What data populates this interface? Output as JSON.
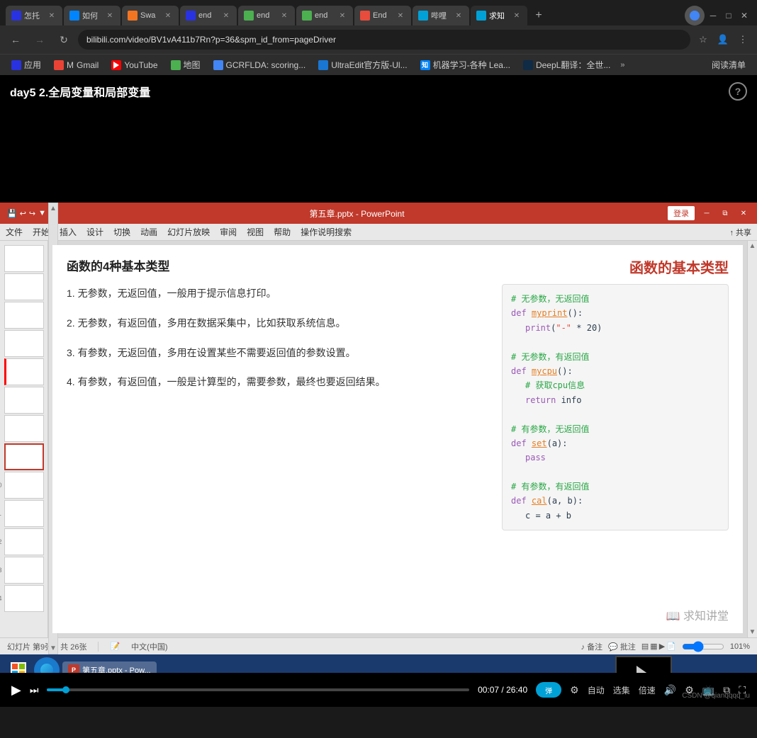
{
  "browser": {
    "tabs": [
      {
        "id": "t1",
        "label": "怎托",
        "fav_color": "#2932e1",
        "active": false
      },
      {
        "id": "t2",
        "label": "如何",
        "fav_color": "#0084ff",
        "active": false
      },
      {
        "id": "t3",
        "label": "Swa",
        "fav_color": "#f47521",
        "active": false
      },
      {
        "id": "t4",
        "label": "end",
        "fav_color": "#2932e1",
        "active": false
      },
      {
        "id": "t5",
        "label": "end",
        "fav_color": "#4caf50",
        "active": false
      },
      {
        "id": "t6",
        "label": "end",
        "fav_color": "#4caf50",
        "active": false
      },
      {
        "id": "t7",
        "label": "End",
        "fav_color": "#e74c3c",
        "active": false
      },
      {
        "id": "t8",
        "label": "哔哩",
        "fav_color": "#00a1d6",
        "active": false
      },
      {
        "id": "t9",
        "label": "求知",
        "fav_color": "#00a1d6",
        "active": true
      }
    ],
    "address": "bilibili.com/video/BV1vA411b7Rn?p=36&spm_id_from=pageDriver",
    "bookmarks": [
      {
        "label": "应用",
        "fav_color": "#2932e1"
      },
      {
        "label": "Gmail",
        "fav_color": "#ea4335"
      },
      {
        "label": "YouTube",
        "fav_color": "#ff0000"
      },
      {
        "label": "地图",
        "fav_color": "#4caf50"
      },
      {
        "label": "GCRFLDA: scoring...",
        "fav_color": "#4285f4"
      },
      {
        "label": "UltraEdit官方版-Ul...",
        "fav_color": "#1976d2"
      },
      {
        "label": "机器学习-各种 Lea...",
        "fav_color": "#0084ff"
      },
      {
        "label": "DeepL翻译：全世...",
        "fav_color": "#0f2b46"
      },
      {
        "label": "阅读清单",
        "fav_color": "#555"
      }
    ]
  },
  "video": {
    "title": "day5 2.全局变量和局部变量",
    "current_time": "00:07",
    "total_time": "26:40",
    "progress_pct": 4.5,
    "controls": {
      "play": "▶",
      "next": "⏭",
      "auto_label": "自动",
      "select_label": "选集",
      "speed_label": "倍速"
    }
  },
  "powerpoint": {
    "title": "第五章.pptx - PowerPoint",
    "login_btn": "登录",
    "menu_items": [
      "文件",
      "开始",
      "插入",
      "设计",
      "切换",
      "动画",
      "幻灯片放映",
      "审阅",
      "视图",
      "帮助",
      "操作说明搜索"
    ],
    "slide": {
      "heading": "函数的4种基本类型",
      "right_title": "函数的基本类型",
      "items": [
        {
          "num": "1",
          "text": "无参数，无返回值，一般用于提示信息打印。"
        },
        {
          "num": "2",
          "text": "无参数，有返回值，多用在数据采集中，比如获取系统信息。"
        },
        {
          "num": "3",
          "text": "有参数，无返回值，多用在设置某些不需要返回值的参数设置。"
        },
        {
          "num": "4",
          "text": "有参数，有返回值，一般是计算型的，需要参数，最终也要返回结果。"
        }
      ],
      "code_sections": [
        {
          "comment": "# 无参数，无返回值",
          "lines": [
            "def myprint():",
            "    print(\"-\" * 20)"
          ]
        },
        {
          "comment": "# 无参数，有返回值",
          "lines": [
            "def mycpu():",
            "    # 获取cpu信息",
            "    return info"
          ]
        },
        {
          "comment": "# 有参数，无返回值",
          "lines": [
            "def set(a):",
            "    pass"
          ]
        },
        {
          "comment": "# 有参数，有返回值",
          "lines": [
            "def cal(a, b):",
            "    c = a + b"
          ]
        }
      ],
      "brand": "📖 求知讲堂"
    },
    "status": {
      "slide_info": "幻灯片 第9张，共 26张",
      "lang": "中文(中国)",
      "zoom": "101%"
    }
  },
  "taskbar": {
    "items": [
      {
        "label": "第五章.pptx - Pow...",
        "active": true
      }
    ]
  }
}
